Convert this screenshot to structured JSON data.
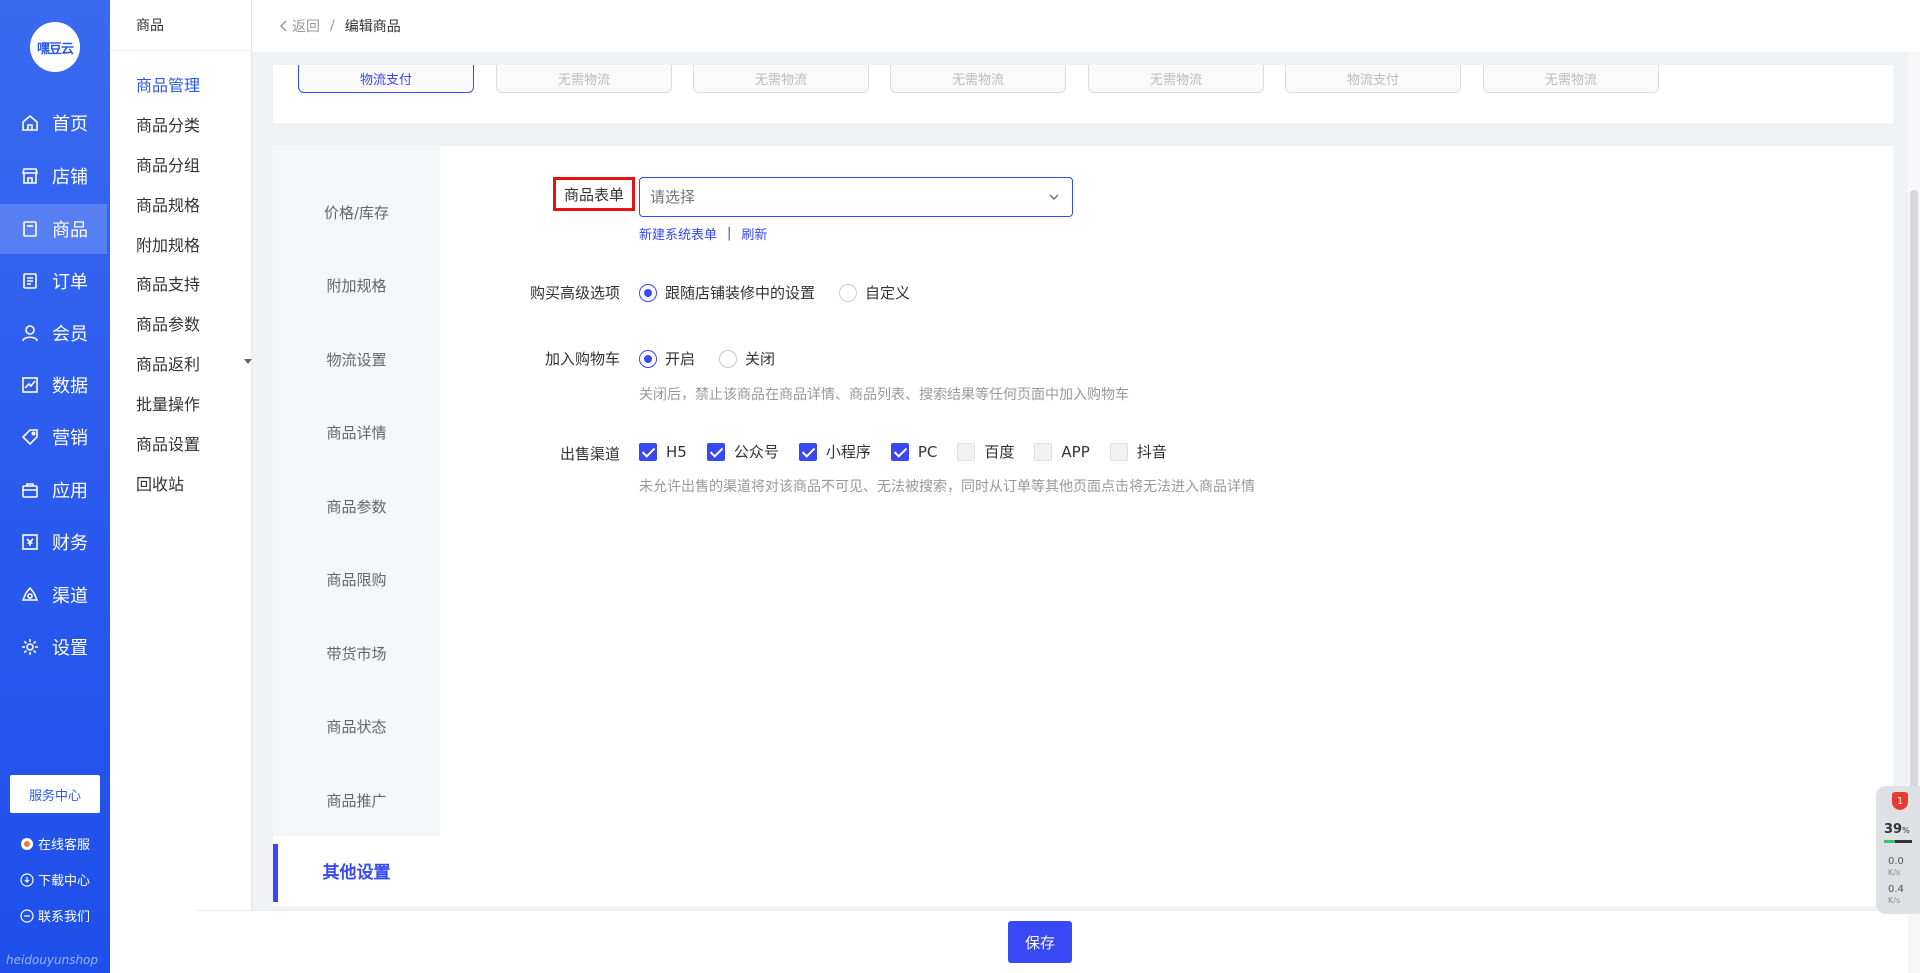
{
  "brand": {
    "logo_text": "嘿豆云",
    "footer_text": "heidouyunshop"
  },
  "nav": {
    "items": [
      {
        "label": "首页",
        "icon": "home-icon"
      },
      {
        "label": "店铺",
        "icon": "store-icon"
      },
      {
        "label": "商品",
        "icon": "goods-icon",
        "active": true
      },
      {
        "label": "订单",
        "icon": "order-icon"
      },
      {
        "label": "会员",
        "icon": "member-icon"
      },
      {
        "label": "数据",
        "icon": "chart-icon"
      },
      {
        "label": "营销",
        "icon": "tag-icon"
      },
      {
        "label": "应用",
        "icon": "app-icon"
      },
      {
        "label": "财务",
        "icon": "finance-icon"
      },
      {
        "label": "渠道",
        "icon": "channel-icon"
      },
      {
        "label": "设置",
        "icon": "settings-icon"
      }
    ],
    "service_center": "服务中心",
    "links": [
      {
        "label": "在线客服",
        "icon": "customer-service-icon"
      },
      {
        "label": "下载中心",
        "icon": "download-icon"
      },
      {
        "label": "联系我们",
        "icon": "contact-icon"
      }
    ]
  },
  "subnav": {
    "title": "商品",
    "items": [
      "商品管理",
      "商品分类",
      "商品分组",
      "商品规格",
      "附加规格",
      "商品支持",
      "商品参数",
      "商品返利",
      "批量操作",
      "商品设置",
      "回收站"
    ],
    "active_index": 0
  },
  "topbar": {
    "back_label": "返回",
    "separator": "/",
    "current": "编辑商品"
  },
  "top_tabs": [
    "物流支付",
    "无需物流",
    "无需物流",
    "无需物流",
    "无需物流",
    "物流支付",
    "无需物流"
  ],
  "anchors": {
    "items": [
      "价格/库存",
      "附加规格",
      "物流设置",
      "商品详情",
      "商品参数",
      "商品限购",
      "带货市场",
      "商品状态",
      "商品推广"
    ],
    "active": "其他设置"
  },
  "form": {
    "goods_form": {
      "label": "商品表单",
      "placeholder": "请选择",
      "value": "",
      "new_link": "新建系统表单",
      "link_sep": "|",
      "refresh_link": "刷新"
    },
    "advanced": {
      "label": "购买高级选项",
      "options": [
        "跟随店铺装修中的设置",
        "自定义"
      ],
      "selected": 0
    },
    "cart": {
      "label": "加入购物车",
      "options": [
        "开启",
        "关闭"
      ],
      "selected": 0,
      "hint": "关闭后，禁止该商品在商品详情、商品列表、搜索结果等任何页面中加入购物车"
    },
    "channels": {
      "label": "出售渠道",
      "options": [
        {
          "label": "H5",
          "checked": true
        },
        {
          "label": "公众号",
          "checked": true
        },
        {
          "label": "小程序",
          "checked": true
        },
        {
          "label": "PC",
          "checked": true
        },
        {
          "label": "百度",
          "checked": false
        },
        {
          "label": "APP",
          "checked": false
        },
        {
          "label": "抖音",
          "checked": false
        }
      ],
      "hint": "未允许出售的渠道将对该商品不可见、无法被搜索，同时从订单等其他页面点击将无法进入商品详情"
    }
  },
  "footer": {
    "save_label": "保存"
  },
  "widget": {
    "badge": "1",
    "percent": "39",
    "percent_unit": "%",
    "up_value": "0.0",
    "up_unit": "K/s",
    "down_value": "0.4",
    "down_unit": "K/s"
  },
  "colors": {
    "primary": "#3848f5",
    "nav_blue": "#2a59ee",
    "highlight_border": "#e81212"
  }
}
